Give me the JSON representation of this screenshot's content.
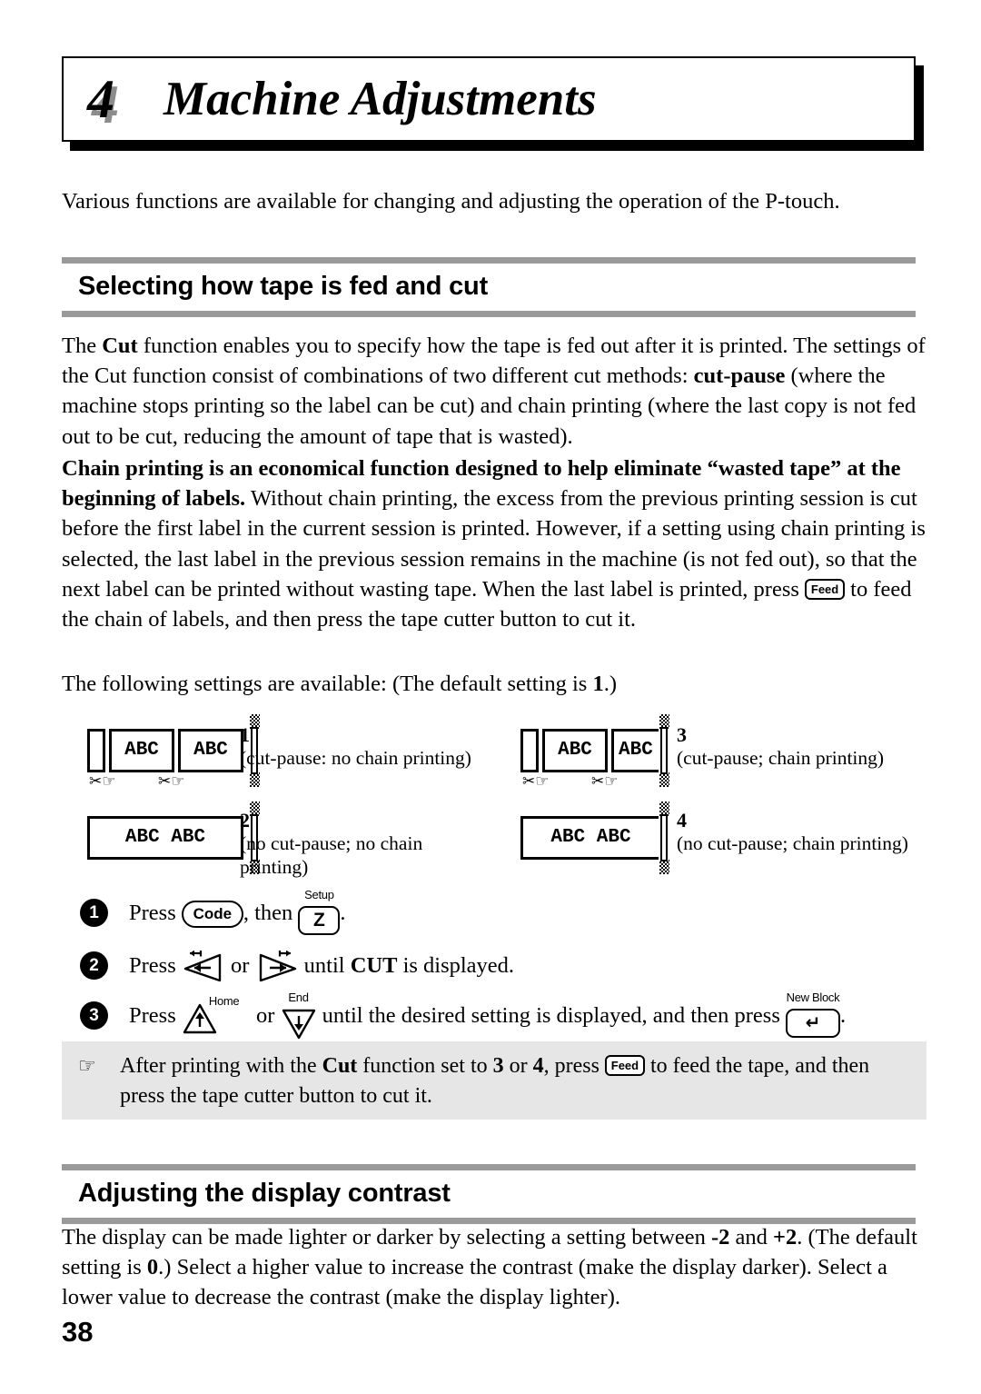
{
  "chapter": {
    "number": "4",
    "title": "Machine Adjustments"
  },
  "intro": "Various functions are available for changing and adjusting the operation of the P-touch.",
  "sections": [
    {
      "title": "Selecting how tape is fed and cut"
    },
    {
      "title": "Adjusting the display contrast"
    }
  ],
  "paragraphs": {
    "cut_intro_1": "The ",
    "cut_intro_bold_1": "Cut",
    "cut_intro_2": " function enables you to specify how the tape is fed out after it is printed. The settings of the Cut function consist of combinations of two different cut methods: ",
    "cut_intro_bold_2": "cut-pause",
    "cut_intro_3": " (where the machine stops printing so the label can be cut) and chain printing (where the last copy is not fed out to be cut, reducing the amount of tape that is wasted).",
    "chain_bold": "Chain printing is an economical function designed to help eliminate “wasted tape” at the beginning of labels.",
    "chain_rest_1": " Without chain printing, the excess from the previous printing session is cut before the first label in the current session is printed. However, if a setting using chain printing is selected, the last label in the previous session remains in the machine (is not fed out), so that the next label can be printed without wasting tape. When the last label is printed, press ",
    "chain_rest_2": " to feed the chain of labels, and then press the tape cutter button to cut it.",
    "available_1": "The following settings are available: (The default setting is ",
    "available_bold": "1",
    "available_2": ".)",
    "contrast_1": "The display can be made lighter or darker by selecting a setting between ",
    "contrast_bold_1": "-2",
    "contrast_2": " and ",
    "contrast_bold_2": "+2",
    "contrast_3": ". (The default setting is ",
    "contrast_bold_3": "0",
    "contrast_4": ".) Select a higher value to increase the contrast (make the display darker). Select a lower value to decrease the contrast (make the display lighter)."
  },
  "settings": [
    {
      "number": "1",
      "description": "(cut-pause: no chain printing)",
      "tape_text_1": "ABC",
      "tape_text_2": "ABC"
    },
    {
      "number": "2",
      "description": "(no cut-pause; no chain printing)",
      "tape_text_1": "ABC ABC"
    },
    {
      "number": "3",
      "description": "(cut-pause; chain printing)",
      "tape_text_1": "ABC",
      "tape_text_2": "ABC"
    },
    {
      "number": "4",
      "description": "(no cut-pause; chain printing)",
      "tape_text_1": "ABC ABC"
    }
  ],
  "steps": [
    {
      "bullet": "1",
      "text_1": "Press ",
      "key_1": "Code",
      "text_2": ", then ",
      "key_2": "Z",
      "key_2_sup": "Setup",
      "text_3": "."
    },
    {
      "bullet": "2",
      "text_1": "Press ",
      "text_2": " or ",
      "text_3": " until ",
      "bold": "CUT",
      "text_4": " is displayed."
    },
    {
      "bullet": "3",
      "text_1": "Press ",
      "key_1_sup": "Home",
      "text_2": " or ",
      "key_2_sup": "End",
      "text_3": " until the desired setting is displayed, and then press ",
      "key_3": "↵",
      "key_3_sup": "New Block",
      "text_4": "."
    }
  ],
  "note": {
    "icon": "☞",
    "text_1": "After printing with the ",
    "bold_1": "Cut",
    "text_2": " function set to ",
    "bold_2": "3",
    "text_3": " or ",
    "bold_3": "4",
    "text_4": ", press ",
    "key": "Feed",
    "text_5": " to feed the tape, and then press the tape cutter button to cut it."
  },
  "keys": {
    "feed": "Feed"
  },
  "page_number": "38",
  "colors": {
    "rule": "#9a9a9a",
    "note_bg": "#e6e6e6",
    "shadow": "#8c8c8c"
  }
}
